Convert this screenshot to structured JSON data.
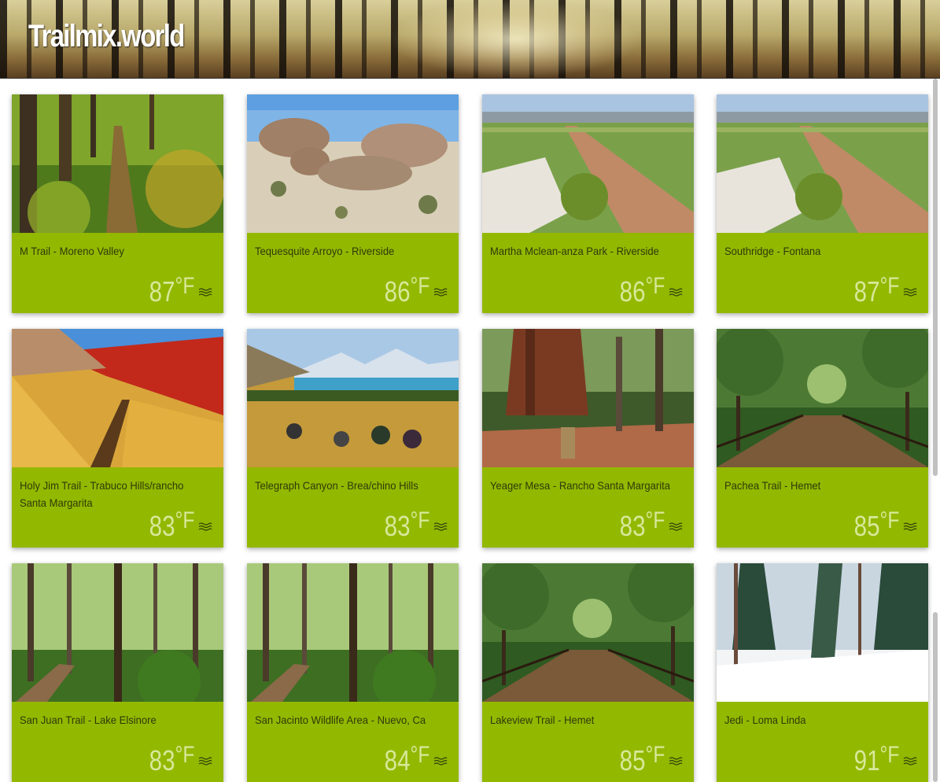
{
  "site": {
    "title": "Trailmix.world"
  },
  "colors": {
    "card_bg": "#93b800",
    "temp_text": "#d8e89a",
    "name_text": "#2e3a0a"
  },
  "trails": [
    {
      "name": "M Trail - Moreno Valley",
      "temp": "87",
      "unit": "°F",
      "icon": "wind-icon",
      "photo": "green-forest-path"
    },
    {
      "name": "Tequesquite Arroyo - Riverside",
      "temp": "86",
      "unit": "°F",
      "icon": "wind-icon",
      "photo": "desert-rocks"
    },
    {
      "name": "Martha Mclean-anza Park - Riverside",
      "temp": "86",
      "unit": "°F",
      "icon": "wind-icon",
      "photo": "dirt-road-hill"
    },
    {
      "name": "Southridge - Fontana",
      "temp": "87",
      "unit": "°F",
      "icon": "wind-icon",
      "photo": "dirt-road-hill"
    },
    {
      "name": "Holy Jim Trail - Trabuco Hills/rancho Santa Margarita",
      "temp": "83",
      "unit": "°F",
      "icon": "wind-icon",
      "photo": "golden-grass-hill"
    },
    {
      "name": "Telegraph Canyon - Brea/chino Hills",
      "temp": "83",
      "unit": "°F",
      "icon": "wind-icon",
      "photo": "mountain-lake-bikers"
    },
    {
      "name": "Yeager Mesa - Rancho Santa Margarita",
      "temp": "83",
      "unit": "°F",
      "icon": "wind-icon",
      "photo": "sequoia-tree"
    },
    {
      "name": "Pachea Trail - Hemet",
      "temp": "85",
      "unit": "°F",
      "icon": "wind-icon",
      "photo": "boardwalk-forest"
    },
    {
      "name": "San Juan Trail - Lake Elsinore",
      "temp": "83",
      "unit": "°F",
      "icon": "wind-icon",
      "photo": "tall-trees-path"
    },
    {
      "name": "San Jacinto Wildlife Area - Nuevo, Ca",
      "temp": "84",
      "unit": "°F",
      "icon": "wind-icon",
      "photo": "tall-trees-path"
    },
    {
      "name": "Lakeview Trail - Hemet",
      "temp": "85",
      "unit": "°F",
      "icon": "wind-icon",
      "photo": "boardwalk-forest"
    },
    {
      "name": "Jedi - Loma Linda",
      "temp": "91",
      "unit": "°F",
      "icon": "wind-icon",
      "photo": "snowy-forest"
    }
  ]
}
